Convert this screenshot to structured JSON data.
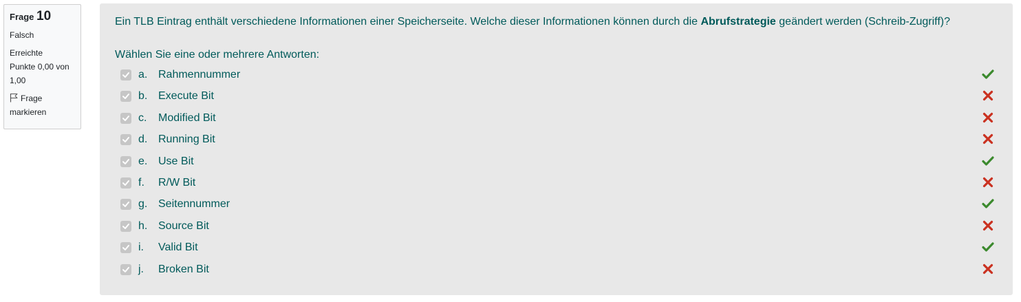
{
  "info": {
    "question_word": "Frage",
    "question_number": "10",
    "state": "Falsch",
    "grade_line1": "Erreichte",
    "grade_line2": "Punkte 0,00 von",
    "grade_line3": "1,00",
    "flag_line1": "Frage",
    "flag_line2": "markieren",
    "flag_icon": "flag-outline-icon"
  },
  "question": {
    "text_before": "Ein TLB Eintrag enthält verschiedene Informationen einer Speicherseite. Welche dieser Informationen können durch die ",
    "text_bold": "Abrufstrategie",
    "text_after": " geändert werden (Schreib-Zugriff)?",
    "prompt": "Wählen Sie eine oder mehrere Antworten:"
  },
  "answers": [
    {
      "letter": "a.",
      "label": "Rahmennummer",
      "checked": true,
      "result": "correct"
    },
    {
      "letter": "b.",
      "label": "Execute Bit",
      "checked": true,
      "result": "incorrect"
    },
    {
      "letter": "c.",
      "label": "Modified Bit",
      "checked": true,
      "result": "incorrect"
    },
    {
      "letter": "d.",
      "label": "Running Bit",
      "checked": true,
      "result": "incorrect"
    },
    {
      "letter": "e.",
      "label": "Use Bit",
      "checked": true,
      "result": "correct"
    },
    {
      "letter": "f.",
      "label": "R/W Bit",
      "checked": true,
      "result": "incorrect"
    },
    {
      "letter": "g.",
      "label": "Seitennummer",
      "checked": true,
      "result": "correct"
    },
    {
      "letter": "h.",
      "label": "Source Bit",
      "checked": true,
      "result": "incorrect"
    },
    {
      "letter": "i.",
      "label": "Valid Bit",
      "checked": true,
      "result": "correct"
    },
    {
      "letter": "j.",
      "label": "Broken Bit",
      "checked": true,
      "result": "incorrect"
    }
  ],
  "colors": {
    "correct": "#3c8a2e",
    "incorrect": "#ca3120",
    "text": "#005a5a",
    "panel": "#e8e8e8"
  }
}
